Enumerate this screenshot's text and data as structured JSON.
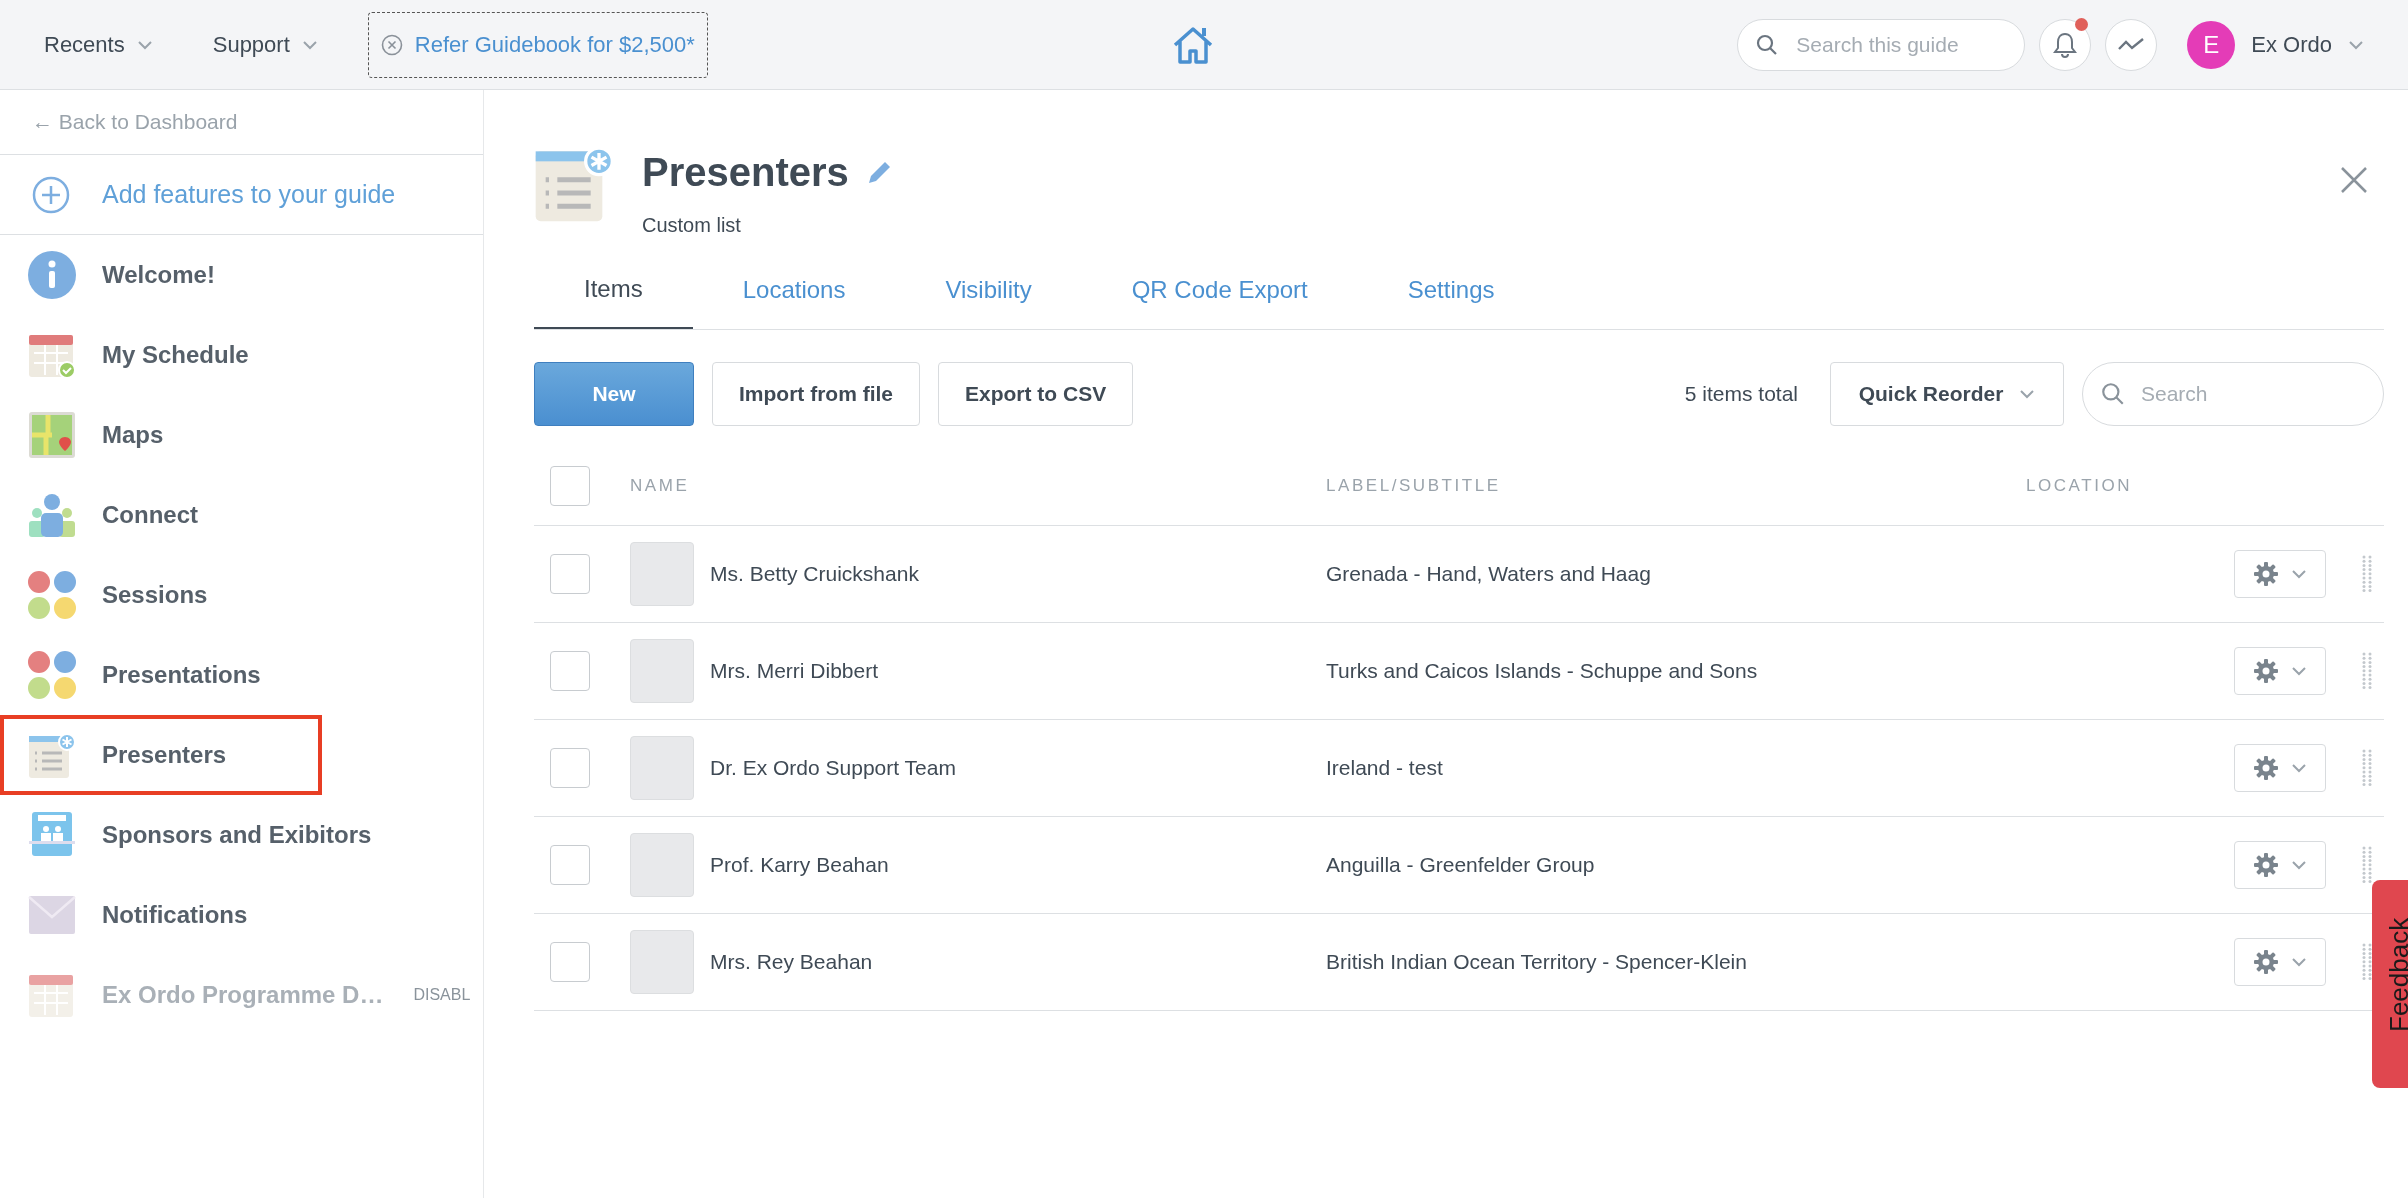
{
  "topbar": {
    "menus": [
      "Recents",
      "Support"
    ],
    "referral": "Refer Guidebook for $2,500*",
    "search": {
      "placeholder": "Search this guide"
    },
    "notifications_unread": true,
    "user": {
      "initial": "E",
      "name": "Ex Ordo"
    }
  },
  "sidebar": {
    "back_link": "← Back to Dashboard",
    "add_feature": "Add features to your guide",
    "items": [
      {
        "label": "Welcome!",
        "selected": false,
        "disabled": false
      },
      {
        "label": "My Schedule",
        "selected": false,
        "disabled": false
      },
      {
        "label": "Maps",
        "selected": false,
        "disabled": false
      },
      {
        "label": "Connect",
        "selected": false,
        "disabled": false
      },
      {
        "label": "Sessions",
        "selected": false,
        "disabled": false
      },
      {
        "label": "Presentations",
        "selected": false,
        "disabled": false
      },
      {
        "label": "Presenters",
        "selected": true,
        "disabled": false
      },
      {
        "label": "Sponsors and Exibitors",
        "selected": false,
        "disabled": false
      },
      {
        "label": "Notifications",
        "selected": false,
        "disabled": false
      },
      {
        "label": "Ex Ordo Programme D…",
        "selected": false,
        "disabled": true,
        "badge": "DISABL"
      }
    ]
  },
  "header": {
    "title": "Presenters",
    "subtitle": "Custom list"
  },
  "tabs": [
    {
      "label": "Items",
      "selected": true
    },
    {
      "label": "Locations",
      "selected": false
    },
    {
      "label": "Visibility",
      "selected": false
    },
    {
      "label": "QR Code Export",
      "selected": false
    },
    {
      "label": "Settings",
      "selected": false
    }
  ],
  "toolbar": {
    "buttons": [
      {
        "label": "New",
        "kind": "primary"
      },
      {
        "label": "Import from file",
        "kind": "secondary"
      },
      {
        "label": "Export to CSV",
        "kind": "secondary"
      }
    ],
    "count": "5 items total",
    "reorder": "Quick Reorder",
    "search": {
      "placeholder": "Search"
    }
  },
  "table": {
    "select_all": {
      "checked": false
    },
    "columns": [
      "NAME",
      "LABEL/SUBTITLE",
      "LOCATION"
    ],
    "rows": [
      {
        "name": "Ms. Betty Cruickshank",
        "label": "Grenada - Hand, Waters and Haag",
        "checked": false
      },
      {
        "name": "Mrs. Merri Dibbert",
        "label": "Turks and Caicos Islands - Schuppe and Sons",
        "checked": false
      },
      {
        "name": "Dr. Ex Ordo Support Team",
        "label": "Ireland - test",
        "checked": false
      },
      {
        "name": "Prof. Karry Beahan",
        "label": "Anguilla - Greenfelder Group",
        "checked": false
      },
      {
        "name": "Mrs. Rey Beahan",
        "label": "British Indian Ocean Territory - Spencer-Klein",
        "checked": false
      }
    ]
  },
  "feedback": "Feedback"
}
